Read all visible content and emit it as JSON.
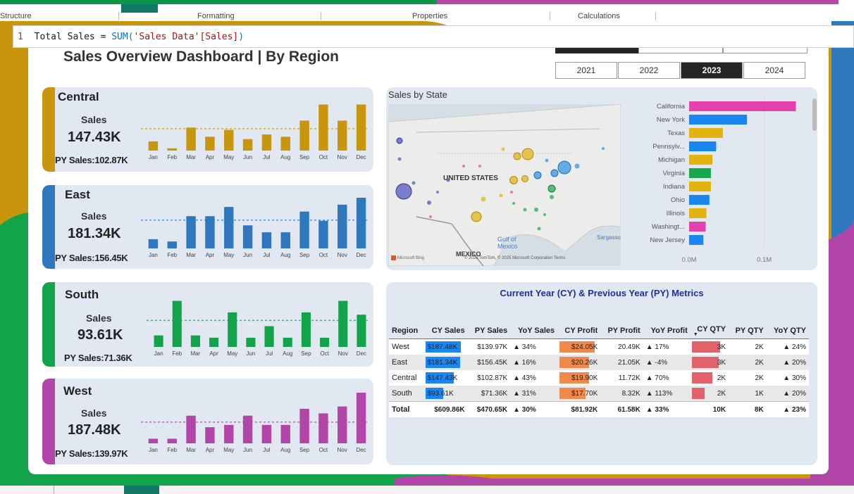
{
  "ribbon": {
    "sections": [
      "Structure",
      "Formatting",
      "Properties",
      "Calculations"
    ]
  },
  "formula": {
    "line_no": "1",
    "measure": "Total Sales",
    "eq": " = ",
    "fn": "SUM(",
    "arg": "'Sales Data'[Sales]",
    "close": ")"
  },
  "dashboard": {
    "title": "Sales Overview Dashboard | By Region",
    "years": [
      "2021",
      "2022",
      "2023",
      "2024"
    ],
    "selected_year": "2023"
  },
  "colors": {
    "central": "#c7960c",
    "east": "#2f78bd",
    "south": "#12a34b",
    "west": "#b245a8",
    "panel": "#e1e8f2"
  },
  "months": [
    "Jan",
    "Feb",
    "Mar",
    "Apr",
    "May",
    "Jun",
    "Jul",
    "Aug",
    "Sep",
    "Oct",
    "Nov",
    "Dec"
  ],
  "regions": [
    {
      "name": "Central",
      "sales_label": "Sales",
      "sales": "147.43K",
      "py_sales": "PY Sales:102.87K",
      "color": "#c7960c",
      "values": [
        4,
        1,
        10,
        6,
        9,
        5,
        7,
        6,
        13,
        20,
        13,
        20
      ],
      "avg_line": 9.5
    },
    {
      "name": "East",
      "sales_label": "Sales",
      "sales": "181.34K",
      "py_sales": "PY Sales:156.45K",
      "color": "#2f78bd",
      "values": [
        4,
        3,
        14,
        14,
        18,
        10,
        7,
        7,
        16,
        12,
        19,
        22
      ],
      "avg_line": 12.3
    },
    {
      "name": "South",
      "sales_label": "Sales",
      "sales": "93.61K",
      "py_sales": "PY Sales:71.36K",
      "color": "#12a34b",
      "values": [
        5,
        20,
        5,
        4,
        15,
        4,
        9,
        4,
        15,
        4,
        20,
        14
      ],
      "avg_line": 11.5
    },
    {
      "name": "West",
      "sales_label": "Sales",
      "sales": "187.48K",
      "py_sales": "PY Sales:139.97K",
      "color": "#b245a8",
      "values": [
        2,
        2,
        12,
        7,
        8,
        12,
        8,
        8,
        15,
        13,
        16,
        22
      ],
      "avg_line": 9.2
    }
  ],
  "map": {
    "title": "Sales by State",
    "country_label": "UNITED STATES",
    "gulf_label": "Gulf of Mexico",
    "mexico_label": "MEXICO",
    "sargasso_label": "Sargasso",
    "credits": "© 2025 TomTom, © 2025 Microsoft Corporation  Terms",
    "bing_label": "Microsoft Bing"
  },
  "chart_data": {
    "type": "bar",
    "orientation": "horizontal",
    "categories": [
      "California",
      "New York",
      "Texas",
      "Pennsylv...",
      "Michigan",
      "Virginia",
      "Indiana",
      "Ohio",
      "Illinois",
      "Washingt...",
      "New Jersey"
    ],
    "values": [
      142000,
      77000,
      45000,
      36000,
      31000,
      29000,
      29000,
      27000,
      23000,
      22000,
      19000
    ],
    "bar_colors": [
      "#e541ad",
      "#1a86f0",
      "#e2b30c",
      "#1a86f0",
      "#e2b30c",
      "#16a84a",
      "#e2b30c",
      "#1a86f0",
      "#e2b30c",
      "#e541ad",
      "#1a86f0"
    ],
    "x_ticks": [
      "0.0M",
      "0.1M"
    ],
    "xlim": [
      0,
      150000
    ]
  },
  "metrics": {
    "title": "Current Year (CY) & Previous Year (PY) Metrics",
    "headers": [
      "Region",
      "CY Sales",
      "PY Sales",
      "YoY Sales",
      "CY Profit",
      "PY Profit",
      "YoY Profit",
      "CY QTY",
      "PY QTY",
      "YoY QTY"
    ],
    "rows": [
      {
        "region": "West",
        "cy_sales": "$187.48K",
        "cy_sales_frac": 1.0,
        "py_sales": "$139.97K",
        "yoy_sales": "▲ 34%",
        "cy_profit": "$24.05K",
        "cy_profit_frac": 1.0,
        "py_profit": "20.49K",
        "yoy_profit": "▲ 17%",
        "cy_qty": "3K",
        "cy_qty_frac": 1.0,
        "py_qty": "2K",
        "yoy_qty": "▲ 24%"
      },
      {
        "region": "East",
        "cy_sales": "$181.34K",
        "cy_sales_frac": 0.97,
        "py_sales": "$156.45K",
        "yoy_sales": "▲ 16%",
        "cy_profit": "$20.26K",
        "cy_profit_frac": 0.84,
        "py_profit": "21.05K",
        "yoy_profit": "▲ -4%",
        "cy_qty": "3K",
        "cy_qty_frac": 0.95,
        "py_qty": "2K",
        "yoy_qty": "▲ 20%"
      },
      {
        "region": "Central",
        "cy_sales": "$147.43K",
        "cy_sales_frac": 0.79,
        "py_sales": "$102.87K",
        "yoy_sales": "▲ 43%",
        "cy_profit": "$19.90K",
        "cy_profit_frac": 0.83,
        "py_profit": "11.72K",
        "yoy_profit": "▲ 70%",
        "cy_qty": "2K",
        "cy_qty_frac": 0.72,
        "py_qty": "2K",
        "yoy_qty": "▲ 30%"
      },
      {
        "region": "South",
        "cy_sales": "$93.61K",
        "cy_sales_frac": 0.5,
        "py_sales": "$71.36K",
        "yoy_sales": "▲ 31%",
        "cy_profit": "$17.70K",
        "cy_profit_frac": 0.74,
        "py_profit": "8.32K",
        "yoy_profit": "▲ 113%",
        "cy_qty": "2K",
        "cy_qty_frac": 0.45,
        "py_qty": "1K",
        "yoy_qty": "▲ 20%"
      }
    ],
    "total": {
      "region": "Total",
      "cy_sales": "$609.86K",
      "py_sales": "$470.65K",
      "yoy_sales": "▲ 30%",
      "cy_profit": "$81.92K",
      "py_profit": "61.58K",
      "yoy_profit": "▲ 33%",
      "cy_qty": "10K",
      "py_qty": "8K",
      "yoy_qty": "▲ 23%"
    }
  }
}
